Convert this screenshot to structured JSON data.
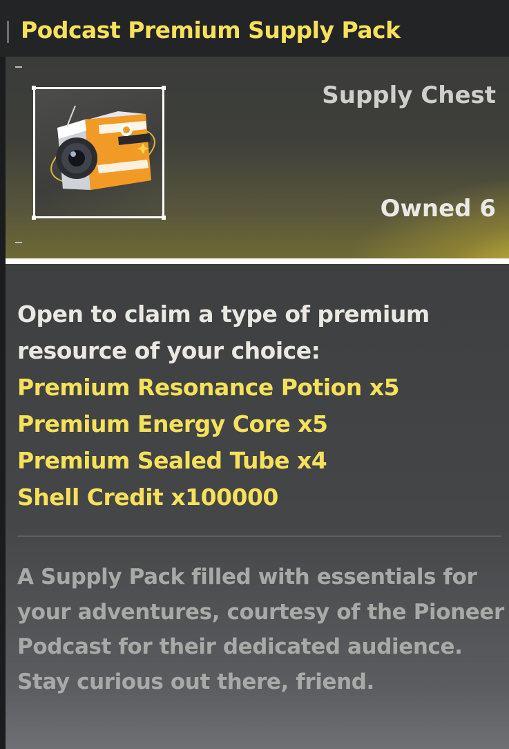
{
  "title": "Podcast Premium Supply Pack",
  "item": {
    "type": "Supply Chest",
    "owned_label": "Owned",
    "owned_count": "6",
    "icon": "supply-chest-icon"
  },
  "intro": "Open to claim a type of premium resource of your choice:",
  "rewards": [
    "Premium Resonance Potion x5",
    "Premium Energy Core x5",
    "Premium Sealed Tube x4",
    "Shell Credit x100000"
  ],
  "description": "A Supply Pack filled with essentials for your adventures, courtesy of the Pioneer Podcast for their dedicated audience. Stay curious out there, friend.",
  "colors": {
    "title": "#f6e15a",
    "reward": "#f6e15a",
    "body": "#ebe8e2",
    "description": "#a9aaa7",
    "icon_orange": "#f29a26"
  }
}
